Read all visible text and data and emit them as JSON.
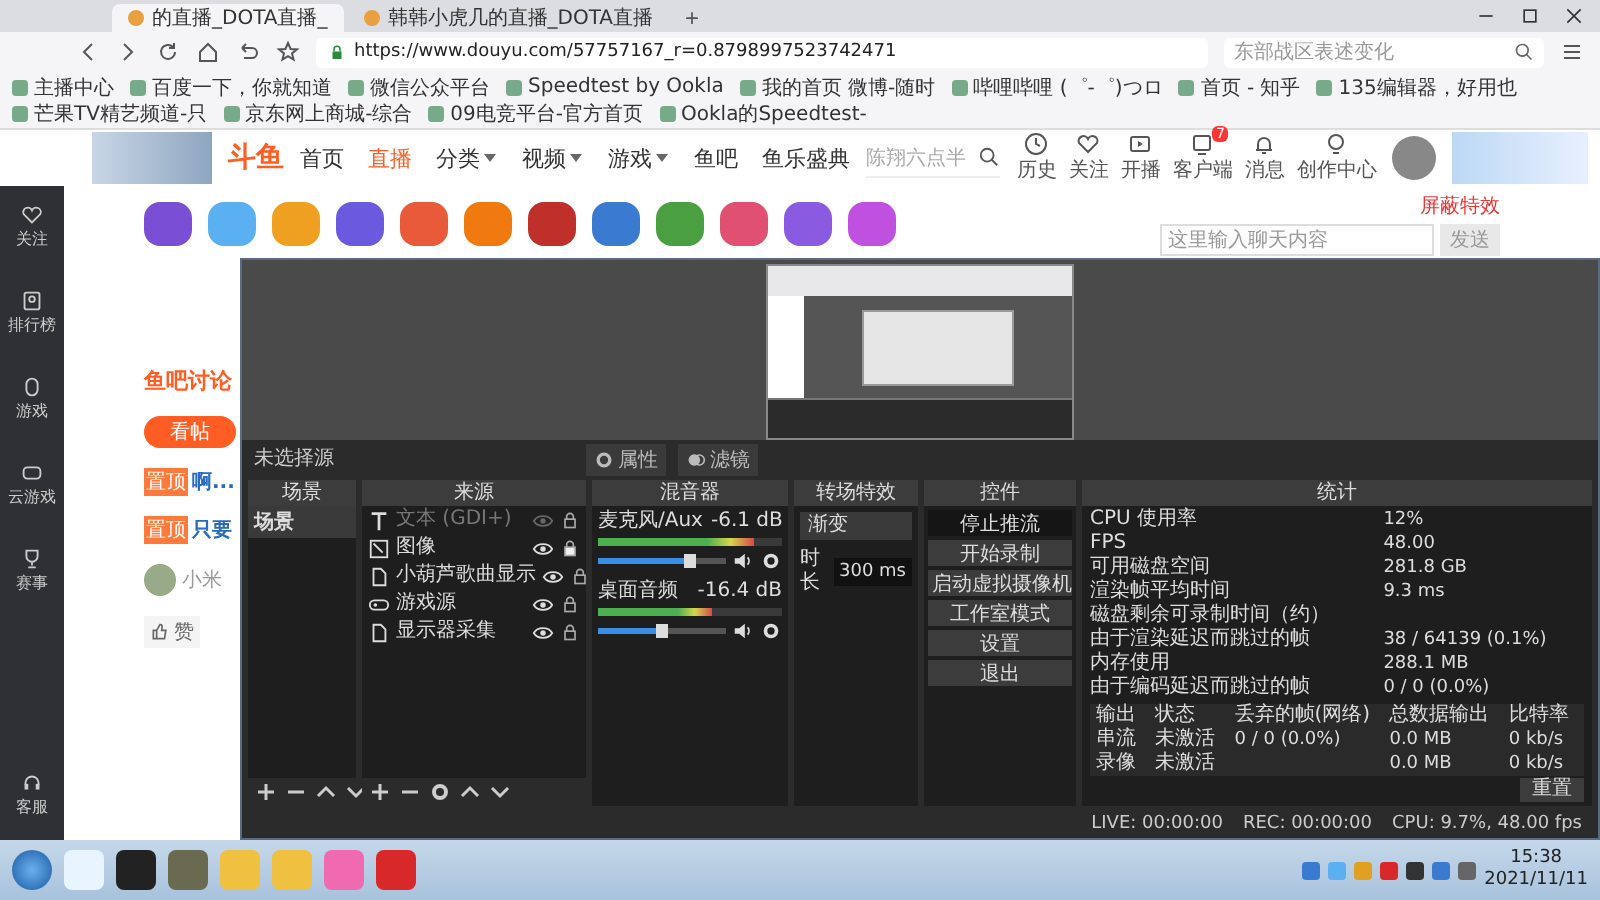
{
  "browser": {
    "tabs": [
      {
        "title": "的直播_DOTA直播_",
        "selected": true
      },
      {
        "title": "韩韩小虎几的直播_DOTA直播",
        "selected": false
      }
    ],
    "new_tab": "+",
    "address": "https://www.douyu.com/57757167_r=0.8798997523742471",
    "search_placeholder": "东部战区表述变化",
    "bookmarks": [
      "主播中心",
      "百度一下，你就知道",
      "微信公众平台",
      "Speedtest by Ookla",
      "我的首页 微博-随时",
      "哔哩哔哩 (゜-゜)つロ",
      "首页 - 知乎",
      "135编辑器，好用也",
      "芒果TV精艺频道-只",
      "京东网上商城-综合",
      "09电竞平台-官方首页",
      "Ookla的Speedtest-"
    ]
  },
  "site": {
    "logo": "斗鱼",
    "nav": [
      {
        "label": "首页",
        "selected": false,
        "dropdown": false
      },
      {
        "label": "直播",
        "selected": true,
        "dropdown": false
      },
      {
        "label": "分类",
        "selected": false,
        "dropdown": true
      },
      {
        "label": "视频",
        "selected": false,
        "dropdown": true
      },
      {
        "label": "游戏",
        "selected": false,
        "dropdown": true
      },
      {
        "label": "鱼吧",
        "selected": false,
        "dropdown": false
      },
      {
        "label": "鱼乐盛典",
        "selected": false,
        "dropdown": false
      }
    ],
    "search_placeholder": "陈翔六点半",
    "tools": [
      {
        "label": "历史"
      },
      {
        "label": "关注"
      },
      {
        "label": "开播"
      },
      {
        "label": "客户端",
        "badge": "7"
      },
      {
        "label": "消息"
      },
      {
        "label": "创作中心"
      }
    ]
  },
  "sidebar": [
    {
      "label": "关注"
    },
    {
      "label": "排行榜"
    },
    {
      "label": "游戏"
    },
    {
      "label": "云游戏"
    },
    {
      "label": "赛事"
    },
    {
      "label": "客服"
    }
  ],
  "chat": {
    "block_effects": "屏蔽特效",
    "placeholder": "这里输入聊天内容",
    "send": "发送"
  },
  "feed": {
    "title": "鱼吧讨论",
    "view_button": "看帖",
    "posts": [
      {
        "tag": "置顶",
        "text": "啊..."
      },
      {
        "tag": "置顶",
        "text": "只要"
      }
    ],
    "comment_user": "小米",
    "like": "赞"
  },
  "obs": {
    "source_status": "未选择源",
    "properties": "属性",
    "filters": "滤镜",
    "scenes": {
      "title": "场景",
      "items": [
        {
          "name": "场景",
          "selected": true
        }
      ]
    },
    "sources": {
      "title": "来源",
      "items": [
        {
          "name": "文本 (GDI+)",
          "kind": "text",
          "visible": false,
          "locked": false
        },
        {
          "name": "图像",
          "kind": "image",
          "visible": true,
          "locked": true
        },
        {
          "name": "小葫芦歌曲显示",
          "kind": "file",
          "visible": true,
          "locked": false
        },
        {
          "name": "游戏源",
          "kind": "game",
          "visible": true,
          "locked": false
        },
        {
          "name": "显示器采集",
          "kind": "file",
          "visible": true,
          "locked": false
        }
      ]
    },
    "mixer": {
      "title": "混音器",
      "channels": [
        {
          "name": "麦克风/Aux",
          "reading": "-6.1 dB",
          "meter": {
            "level": 0.85
          },
          "volume": {
            "level": 0.72
          }
        },
        {
          "name": "桌面音频",
          "reading": "-16.4 dB",
          "meter": {
            "level": 0.62
          },
          "volume": {
            "level": 0.5
          }
        }
      ]
    },
    "transitions": {
      "title": "转场特效",
      "selected": "渐变",
      "duration_label": "时长",
      "duration": "300 ms"
    },
    "controls": {
      "title": "控件",
      "buttons": [
        {
          "label": "停止推流",
          "active": true
        },
        {
          "label": "开始录制",
          "active": false
        },
        {
          "label": "启动虚拟摄像机",
          "active": false
        },
        {
          "label": "工作室模式",
          "active": false
        },
        {
          "label": "设置",
          "active": false
        },
        {
          "label": "退出",
          "active": false
        }
      ]
    },
    "stats": {
      "title": "统计",
      "pairs": [
        {
          "label": "CPU 使用率",
          "value": "12%"
        },
        {
          "label": "FPS",
          "value": "48.00"
        },
        {
          "label": "可用磁盘空间",
          "value": "281.8 GB"
        },
        {
          "label": "渲染帧平均时间",
          "value": "9.3 ms"
        },
        {
          "label": "磁盘剩余可录制时间（约）"
        },
        {
          "label": "由于渲染延迟而跳过的帧",
          "value": "38 / 64139 (0.1%)"
        },
        {
          "label": "内存使用",
          "value": "288.1 MB"
        },
        {
          "label": "由于编码延迟而跳过的帧",
          "value": "0 / 0 (0.0%)"
        }
      ],
      "columns": [
        "输出",
        "状态",
        "丢弃的帧(网络)",
        "总数据输出",
        "比特率"
      ],
      "rows": [
        {
          "output": "串流",
          "status": "未激活",
          "dropped": "0 / 0 (0.0%)",
          "data": "0.0 MB",
          "bitrate": "0 kb/s"
        },
        {
          "output": "录像",
          "status": "未激活",
          "data": "0.0 MB",
          "bitrate": "0 kb/s"
        }
      ],
      "reset": "重置"
    },
    "status_bar": {
      "live": "LIVE: 00:00:00",
      "rec": "REC: 00:00:00",
      "cpu": "CPU: 9.7%, 48.00 fps"
    }
  },
  "taskbar": {
    "time": "15:38",
    "date": "2021/11/11"
  }
}
